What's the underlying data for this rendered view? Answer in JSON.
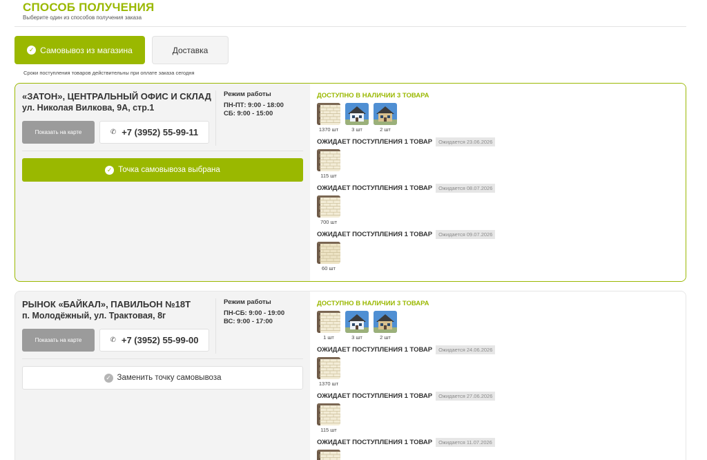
{
  "header": {
    "title": "СПОСОБ ПОЛУЧЕНИЯ",
    "subtitle": "Выберите один из способов получения заказа"
  },
  "tabs": {
    "pickup": "Самовывоз из магазина",
    "delivery": "Доставка"
  },
  "note": "Сроки поступления товаров действительны при оплате заказа сегодня",
  "stores": [
    {
      "name": "«ЗАТОН», ЦЕНТРАЛЬНЫЙ ОФИС И СКЛАД",
      "address": "ул. Николая Вилкова, 9А, стр.1",
      "schedule_title": "Режим работы",
      "schedule_line1": "ПН-ПТ: 9:00 - 18:00",
      "schedule_line2": "СБ: 9:00 - 15:00",
      "map_button": "Показать на карте",
      "phone": "+7 (3952) 55-99-11",
      "action_button": "Точка самовывоза выбрана",
      "available_title": "ДОСТУПНО В НАЛИЧИИ  3  ТОВАРА",
      "available_qty": [
        "1370 шт",
        "3 шт",
        "2 шт"
      ],
      "waiting": [
        {
          "title": "ОЖИДАЕТ ПОСТУПЛЕНИЯ  1  ТОВАР",
          "date": "Ожидается 23.06.2026",
          "qty": "115 шт"
        },
        {
          "title": "ОЖИДАЕТ ПОСТУПЛЕНИЯ  1  ТОВАР",
          "date": "Ожидается 08.07.2026",
          "qty": "700 шт"
        },
        {
          "title": "ОЖИДАЕТ ПОСТУПЛЕНИЯ  1  ТОВАР",
          "date": "Ожидается 09.07.2026",
          "qty": "60 шт"
        }
      ]
    },
    {
      "name": "РЫНОК «БАЙКАЛ», ПАВИЛЬОН №18Т",
      "address": "п. Молодёжный, ул. Трактовая, 8г",
      "schedule_title": "Режим работы",
      "schedule_line1": "ПН-СБ: 9:00 - 19:00",
      "schedule_line2": "ВС: 9:00 - 17:00",
      "map_button": "Показать на карте",
      "phone": "+7 (3952) 55-99-00",
      "action_button": "Заменить точку самовывоза",
      "available_title": "ДОСТУПНО В НАЛИЧИИ  3  ТОВАРА",
      "available_qty": [
        "1 шт",
        "3 шт",
        "2 шт"
      ],
      "waiting": [
        {
          "title": "ОЖИДАЕТ ПОСТУПЛЕНИЯ  1  ТОВАР",
          "date": "Ожидается 24.06.2026",
          "qty": "1370 шт"
        },
        {
          "title": "ОЖИДАЕТ ПОСТУПЛЕНИЯ  1  ТОВАР",
          "date": "Ожидается 27.06.2026",
          "qty": "115 шт"
        },
        {
          "title": "ОЖИДАЕТ ПОСТУПЛЕНИЯ  1  ТОВАР",
          "date": "Ожидается 11.07.2026",
          "qty": ""
        }
      ]
    }
  ],
  "colors": {
    "accent": "#9ab800",
    "card_bg": "#f3f3f3",
    "badge_bg": "#e6e6e6"
  },
  "icons": {
    "check": "check-circle-icon",
    "phone": "phone-icon",
    "product_brick": "brick-product-image",
    "product_house": "house-product-image"
  }
}
